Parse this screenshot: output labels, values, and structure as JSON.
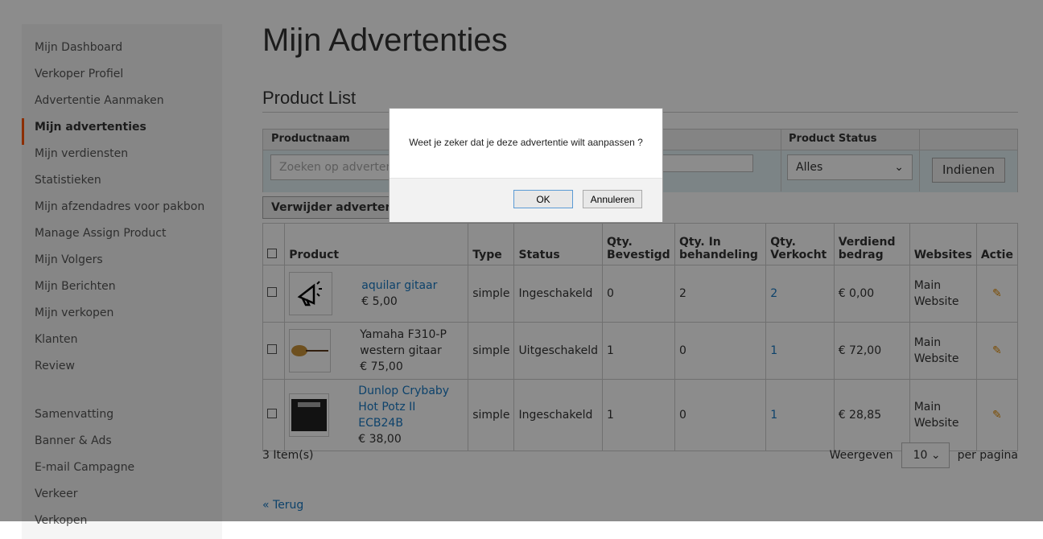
{
  "sidebar": {
    "items": [
      "Mijn Dashboard",
      "Verkoper Profiel",
      "Advertentie Aanmaken",
      "Mijn advertenties",
      "Mijn verdiensten",
      "Statistieken",
      "Mijn afzendadres voor pakbon",
      "Manage Assign Product",
      "Mijn Volgers",
      "Mijn Berichten",
      "Mijn verkopen",
      "Klanten",
      "Review"
    ],
    "items2": [
      "Samenvatting",
      "Banner & Ads",
      "E-mail Campagne",
      "Verkeer",
      "Verkopen"
    ],
    "active_index": 3,
    "accent": "#ff5501"
  },
  "page": {
    "title": "Mijn Advertenties",
    "subtitle": "Product List"
  },
  "filter": {
    "col_productname": "Productnaam",
    "col_status": "Product Status",
    "search_placeholder": "Zoeken op advertentie",
    "status_value": "Alles",
    "submit": "Indienen"
  },
  "delete_button": "Verwijder advertenties",
  "table": {
    "headers": [
      "Product",
      "Type",
      "Status",
      "Qty. Bevestigd",
      "Qty. In behandeling",
      "Qty. Verkocht",
      "Verdiend bedrag",
      "Websites",
      "Actie"
    ],
    "rows": [
      {
        "name": "aquilar gitaar",
        "price": "€ 5,00",
        "type": "simple",
        "status": "Ingeschakeld",
        "confirmed": "0",
        "pending": "2",
        "sold": "2",
        "earned": "€ 0,00",
        "website": "Main Website",
        "name_link": true
      },
      {
        "name": "Yamaha F310-P western gitaar",
        "price": "€ 75,00",
        "type": "simple",
        "status": "Uitgeschakeld",
        "confirmed": "1",
        "pending": "0",
        "sold": "1",
        "earned": "€ 72,00",
        "website": "Main Website",
        "name_link": false
      },
      {
        "name": "Dunlop Crybaby Hot Potz II ECB24B",
        "price": "€ 38,00",
        "type": "simple",
        "status": "Ingeschakeld",
        "confirmed": "1",
        "pending": "0",
        "sold": "1",
        "earned": "€ 28,85",
        "website": "Main Website",
        "name_link": true
      }
    ]
  },
  "pager": {
    "count": "3 Item(s)",
    "show_label": "Weergeven",
    "per_page": "10",
    "per_page_suffix": "per pagina"
  },
  "back_link": "« Terug",
  "dialog": {
    "message": "Weet je zeker dat je deze advertentie wilt aanpassen ?",
    "ok": "OK",
    "cancel": "Annuleren"
  }
}
